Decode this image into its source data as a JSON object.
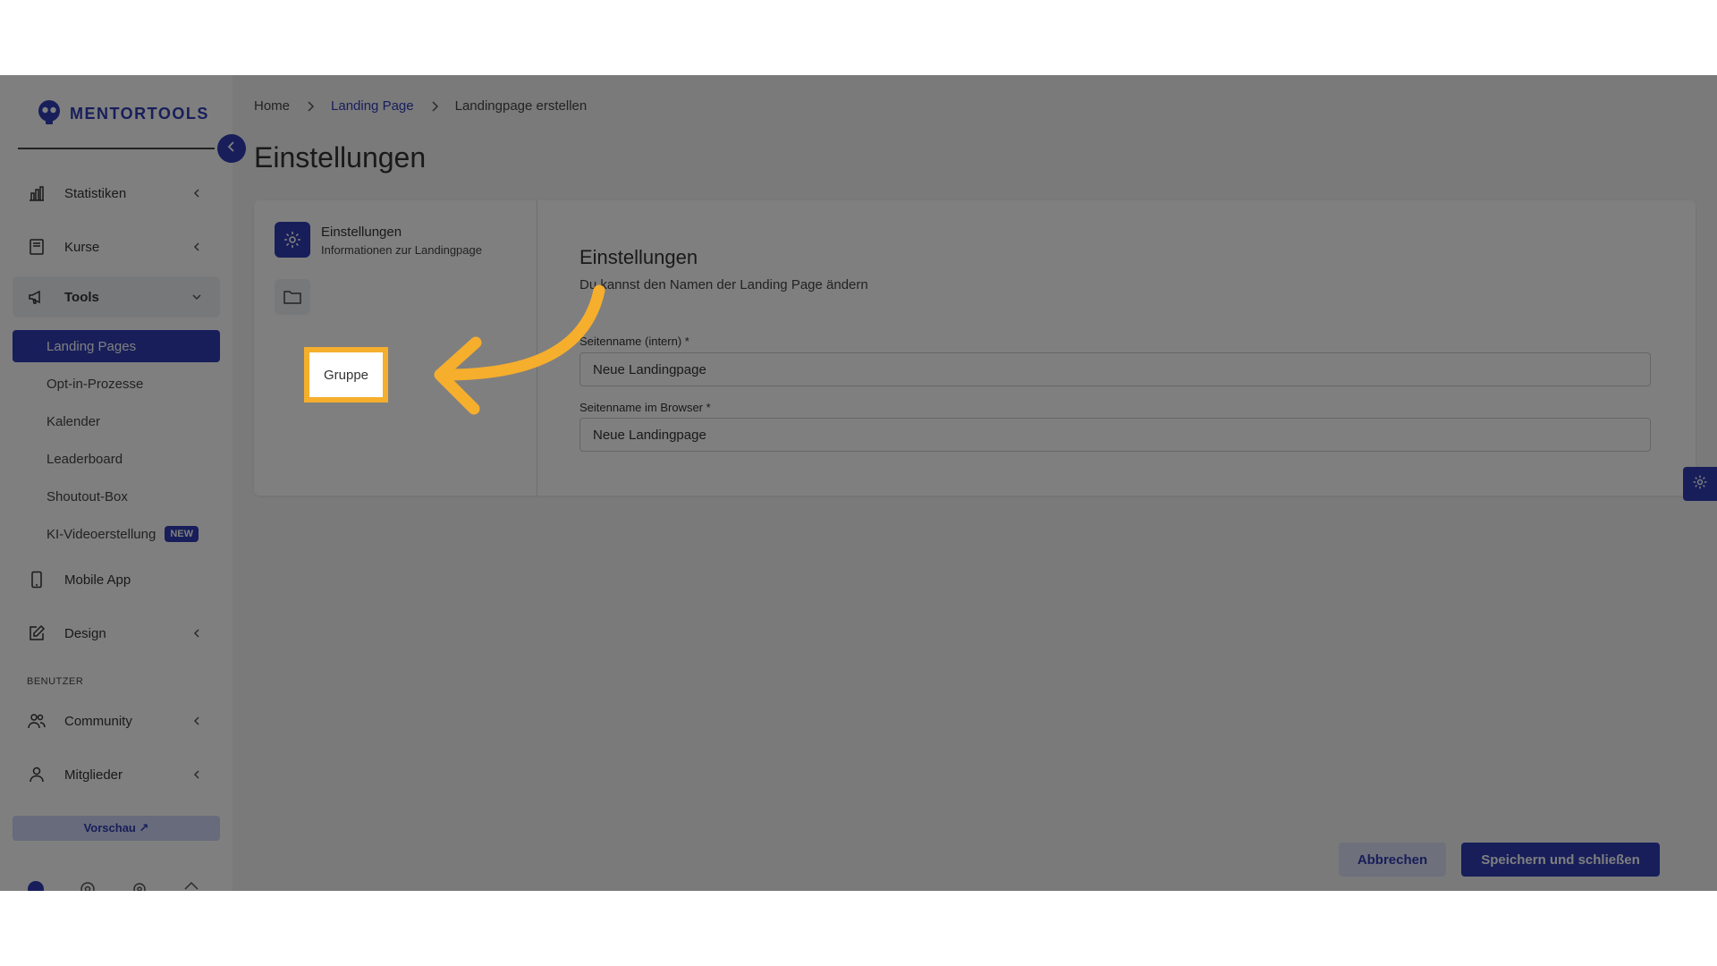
{
  "app": {
    "brand": "MENTORTOOLS"
  },
  "breadcrumb": {
    "home": "Home",
    "landing": "Landing Page",
    "current": "Landingpage erstellen"
  },
  "page_title": "Einstellungen",
  "sidebar": {
    "items": [
      {
        "label": "Statistiken",
        "icon": "bar-chart-icon"
      },
      {
        "label": "Kurse",
        "icon": "book-icon"
      },
      {
        "label": "Tools",
        "icon": "megaphone-icon"
      },
      {
        "label": "Mobile App",
        "icon": "phone-icon"
      },
      {
        "label": "Design",
        "icon": "edit-icon"
      },
      {
        "label": "Community",
        "icon": "users-icon"
      },
      {
        "label": "Mitglieder",
        "icon": "user-icon"
      }
    ],
    "tools_sub": [
      {
        "label": "Landing Pages"
      },
      {
        "label": "Opt-in-Prozesse"
      },
      {
        "label": "Kalender"
      },
      {
        "label": "Leaderboard"
      },
      {
        "label": "Shoutout-Box"
      },
      {
        "label": "KI-Videoerstellung",
        "badge": "NEW"
      }
    ],
    "section_benutzer": "BENUTZER",
    "preview_label": "Vorschau ↗"
  },
  "steps": [
    {
      "title": "Einstellungen",
      "subtitle": "Informationen zur Landingpage",
      "icon": "gear-icon"
    },
    {
      "title": "Gruppe",
      "icon": "folder-icon"
    }
  ],
  "form": {
    "title": "Einstellungen",
    "subtitle": "Du kannst den Namen der Landing Page ändern",
    "fields": [
      {
        "label": "Seitenname (intern) *",
        "value": "Neue Landingpage"
      },
      {
        "label": "Seitenname im Browser *",
        "value": "Neue Landingpage"
      }
    ]
  },
  "actions": {
    "cancel": "Abbrechen",
    "save": "Speichern und schließen"
  },
  "colors": {
    "primary": "#2f3db5",
    "highlight": "#f6ae2d",
    "overlay": "rgba(0,0,0,0.5)"
  }
}
